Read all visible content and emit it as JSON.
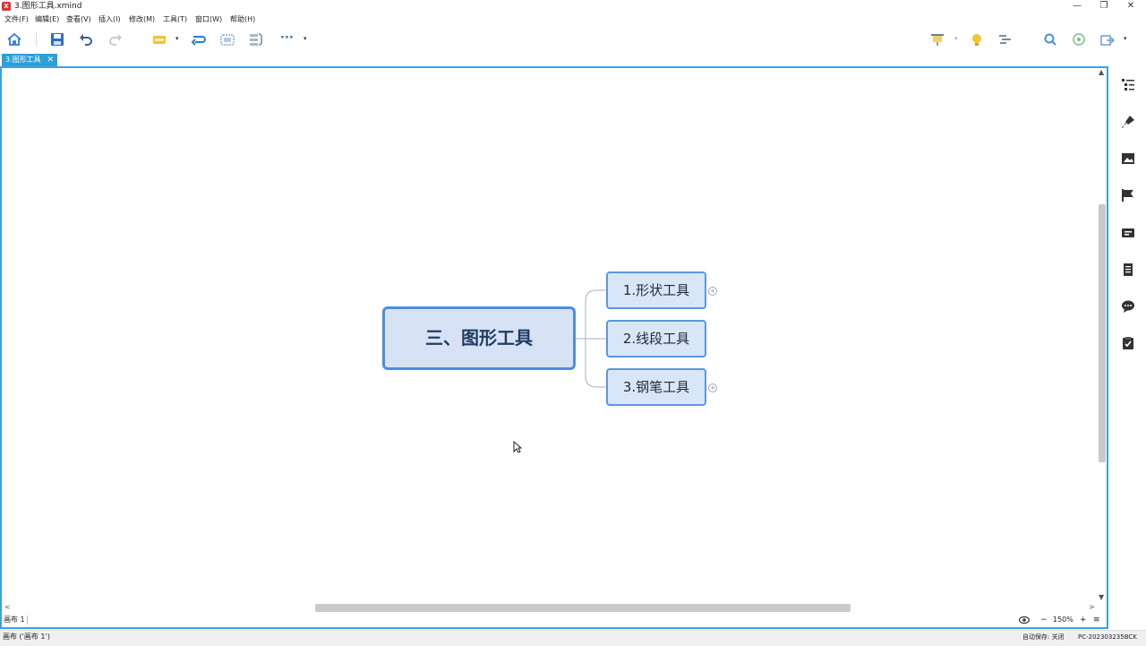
{
  "window": {
    "title": "3.图形工具.xmind",
    "app_badge": "X",
    "controls": [
      "—",
      "❐",
      "✕"
    ]
  },
  "menu": [
    {
      "label": "文件(F)"
    },
    {
      "label": "编辑(E)"
    },
    {
      "label": "查看(V)"
    },
    {
      "label": "插入(I)"
    },
    {
      "label": "修改(M)"
    },
    {
      "label": "工具(T)"
    },
    {
      "label": "窗口(W)"
    },
    {
      "label": "帮助(H)"
    }
  ],
  "toolbar": {
    "more_label": "···",
    "dropdown_glyph": "▾",
    "icons": [
      "home-icon",
      "save-icon",
      "undo-icon",
      "redo-icon",
      "topic-icon",
      "relationship-icon",
      "boundary-icon",
      "summary-icon",
      "more-icon",
      "presentation-icon",
      "brainstorm-icon",
      "gantt-icon",
      "search-icon",
      "share-icon",
      "export-icon"
    ]
  },
  "tab": {
    "label": "3.图形工具",
    "close": "✕"
  },
  "mindmap": {
    "central": "三、图形工具",
    "subtopics": [
      {
        "label": "1.形状工具",
        "expand": "+"
      },
      {
        "label": "2.线段工具",
        "expand": ""
      },
      {
        "label": "3.钢笔工具",
        "expand": "+"
      }
    ],
    "colors": {
      "central_border": "#4c8ee0",
      "central_fill": "#d7e3f5",
      "sub_fill": "#d9e6f7",
      "connector": "#9fb3c8"
    }
  },
  "sheet": {
    "name": "画布 1",
    "zoom": "150%",
    "zoom_minus": "−",
    "zoom_plus": "+",
    "menu_glyph": "≡"
  },
  "scroll": {
    "up": "▲",
    "down": "▼",
    "left": "<",
    "right": ">"
  },
  "status": {
    "text": "画布 ('画布 1')",
    "autosave": "自动保存: 关闭",
    "pc": "PC-202303235BCK"
  },
  "sidebar_icons": [
    "outline-icon",
    "format-brush-icon",
    "image-icon",
    "flag-marker-icon",
    "label-icon",
    "notes-icon",
    "comments-icon",
    "task-icon"
  ],
  "accent": "#2ea0d9"
}
